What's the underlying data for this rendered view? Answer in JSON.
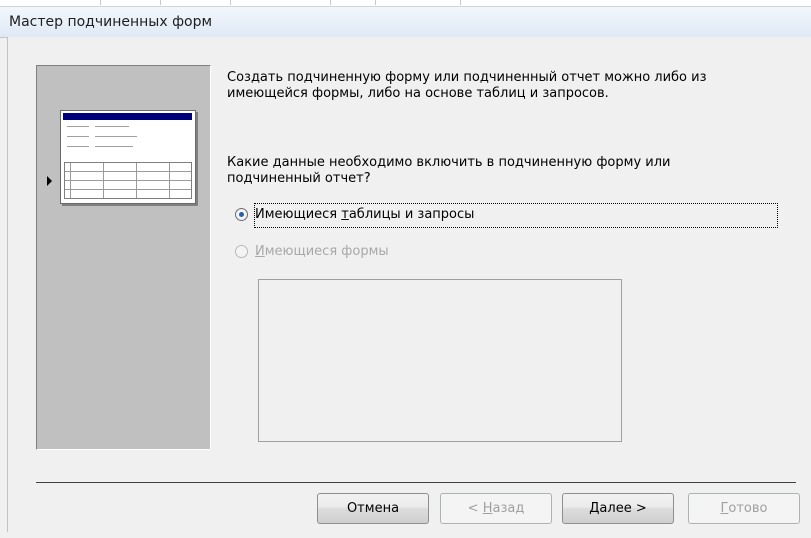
{
  "window": {
    "title": "Мастер подчиненных форм"
  },
  "intro_text": {
    "line1": "Создать подчиненную форму или подчиненный отчет можно либо из",
    "line2": "имеющейся формы, либо на основе таблиц и запросов."
  },
  "question_text": {
    "line1": "Какие данные необходимо включить в подчиненную форму или",
    "line2": "подчиненный отчет?"
  },
  "options": [
    {
      "label_pre": "Имеющиеся ",
      "label_key": "т",
      "label_post": "аблицы и запросы",
      "checked": true,
      "enabled": true
    },
    {
      "label_pre": "",
      "label_key": "И",
      "label_post": "меющиеся формы",
      "checked": false,
      "enabled": false
    }
  ],
  "buttons": {
    "cancel": {
      "label": "Отмена",
      "enabled": true
    },
    "back": {
      "label_pre": "< ",
      "label_key": "Н",
      "label_post": "азад",
      "enabled": false
    },
    "next": {
      "label_key": "Д",
      "label_post": "алее >",
      "enabled": true
    },
    "finish": {
      "label_key": "Г",
      "label_post": "отово",
      "enabled": false
    }
  },
  "colors": {
    "thumb_titlebar": "#00007b",
    "radio_dot": "#275faa",
    "panel_bg": "#c0c0c0"
  }
}
